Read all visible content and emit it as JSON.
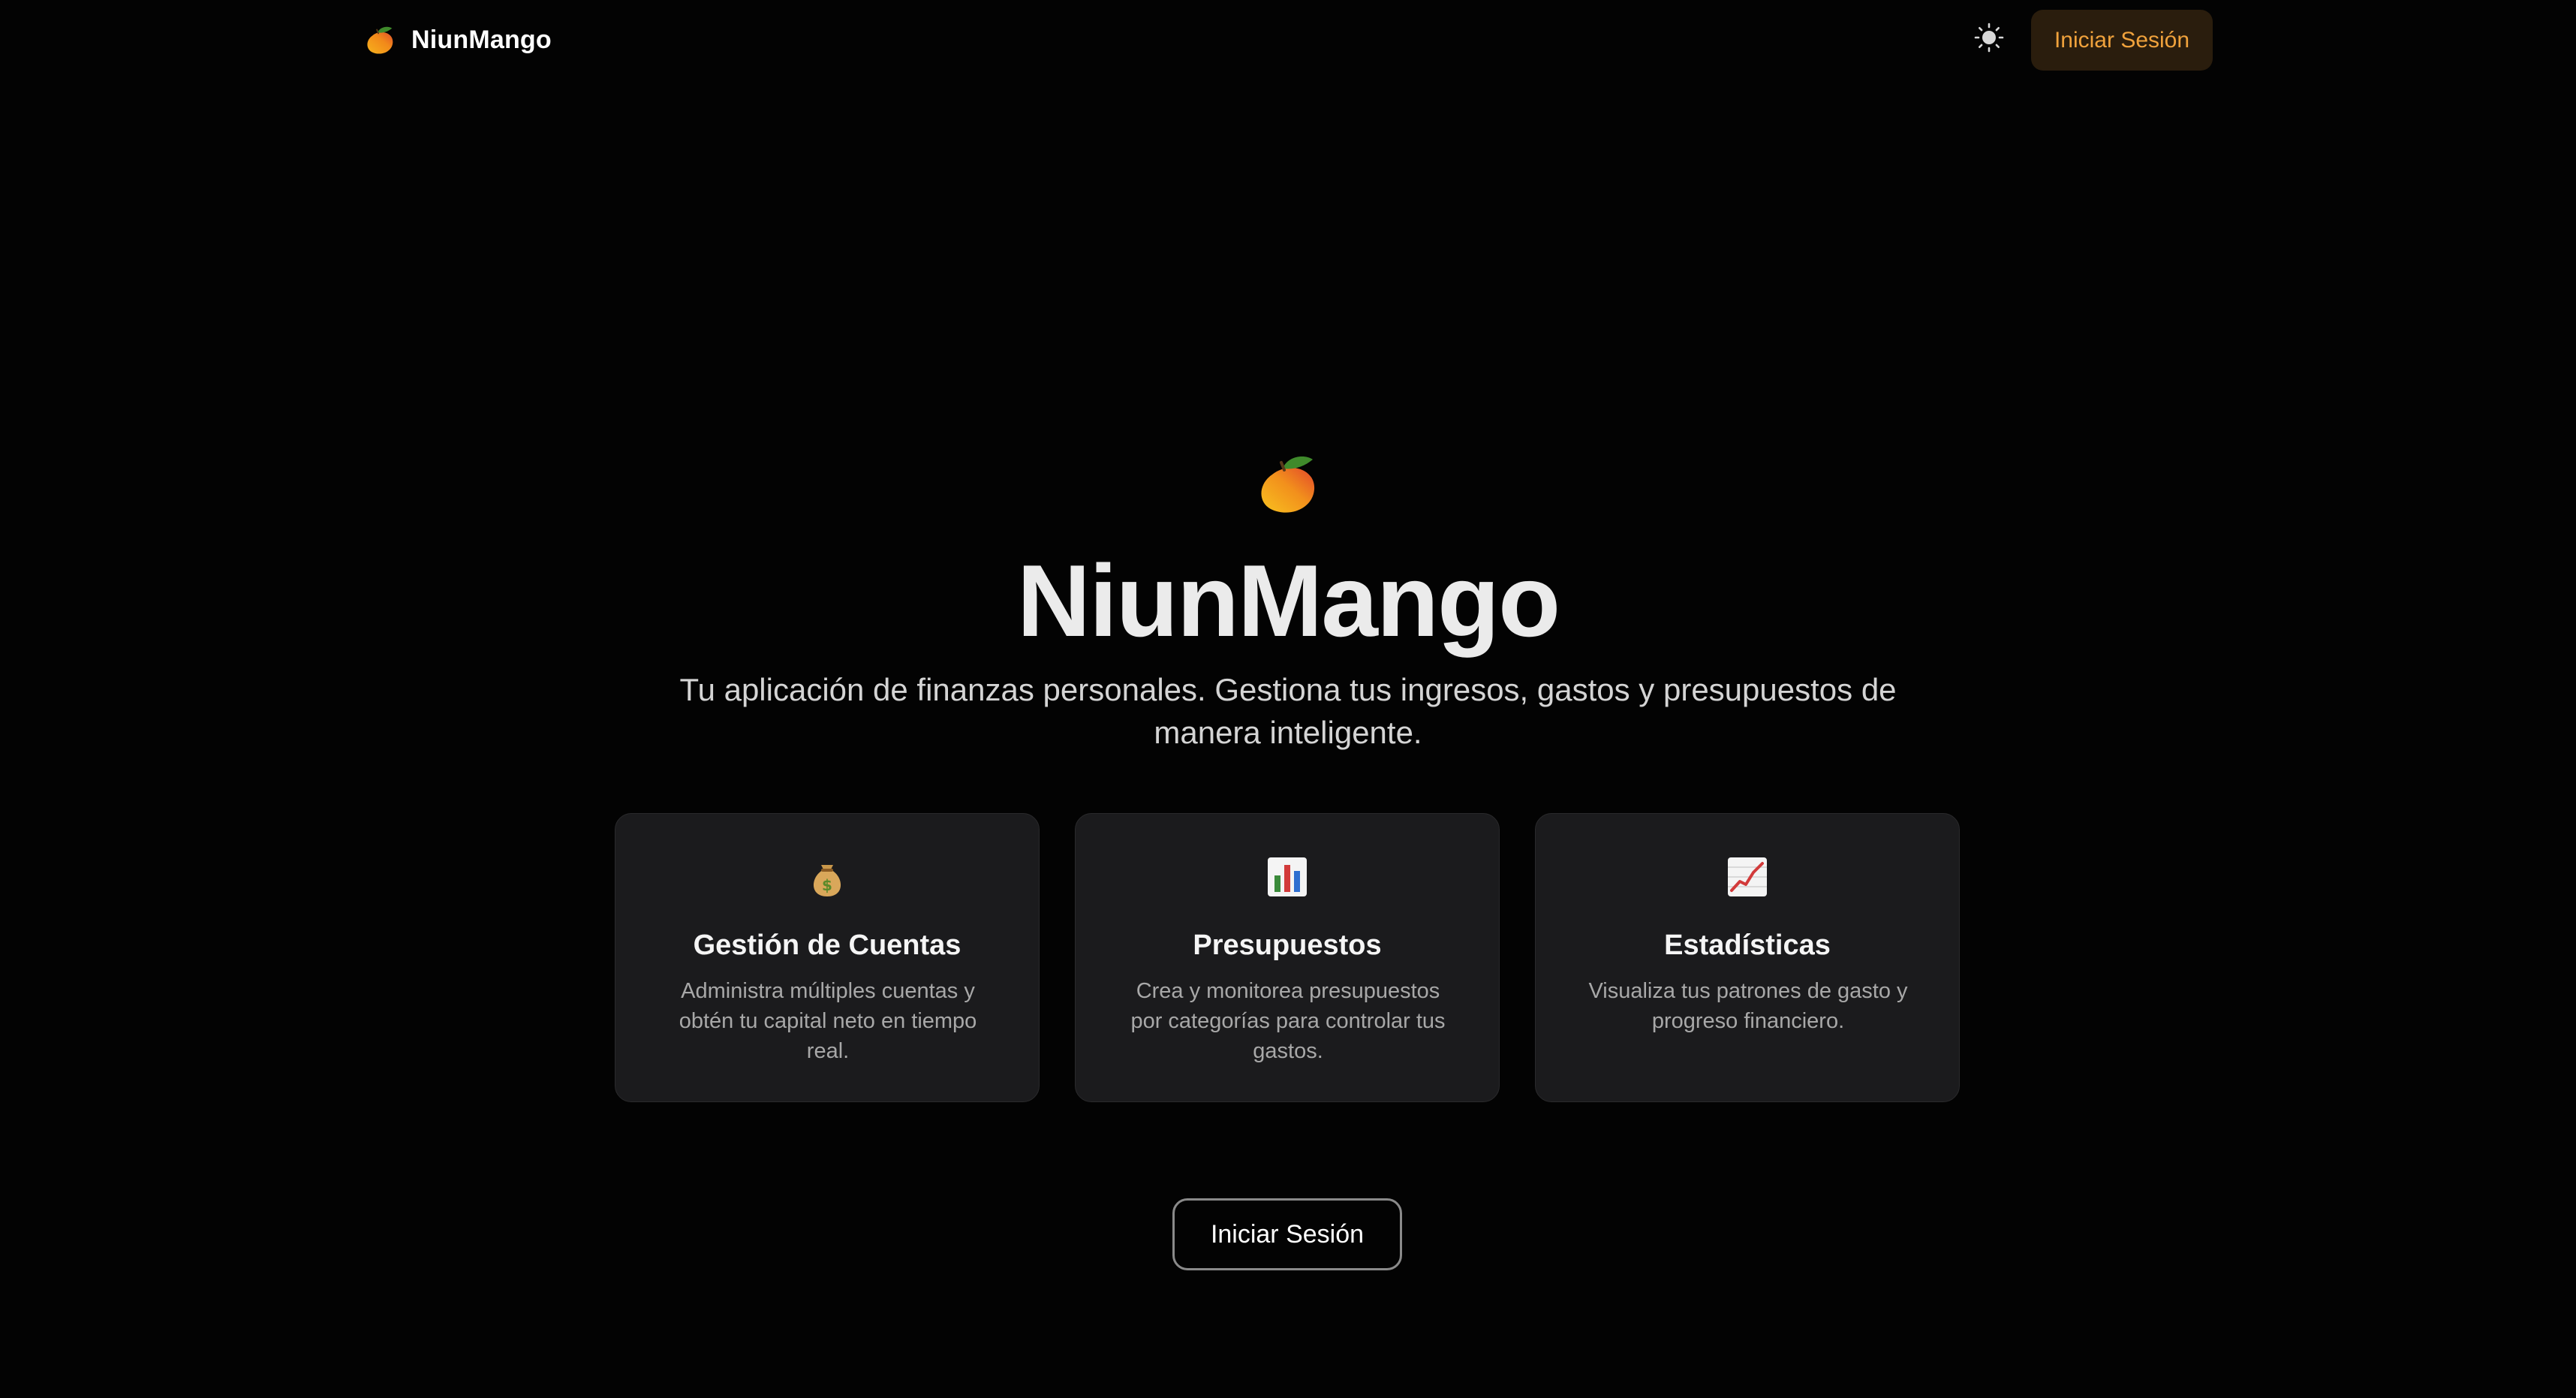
{
  "app": {
    "brand_name": "NiunMango",
    "brand_icon": "mango-icon"
  },
  "header": {
    "theme_toggle_icon": "sun-icon",
    "login_label": "Iniciar Sesión"
  },
  "hero": {
    "icon": "mango-icon",
    "title": "NiunMango",
    "subtitle": "Tu aplicación de finanzas personales. Gestiona tus ingresos, gastos y presupuestos de manera inteligente."
  },
  "features": [
    {
      "icon": "money-bag-icon",
      "title": "Gestión de Cuentas",
      "description": "Administra múltiples cuentas y obtén tu capital neto en tiempo real."
    },
    {
      "icon": "bar-chart-icon",
      "title": "Presupuestos",
      "description": "Crea y monitorea presupuestos por categorías para controlar tus gastos."
    },
    {
      "icon": "trend-up-chart-icon",
      "title": "Estadísticas",
      "description": "Visualiza tus patrones de gasto y progreso financiero."
    }
  ],
  "cta": {
    "login_label": "Iniciar Sesión"
  },
  "colors": {
    "background": "#030303",
    "card_background": "#1b1b1d",
    "accent": "#f0a23c",
    "accent_background": "#2a1d0d",
    "muted_text": "#a8a8a8"
  }
}
